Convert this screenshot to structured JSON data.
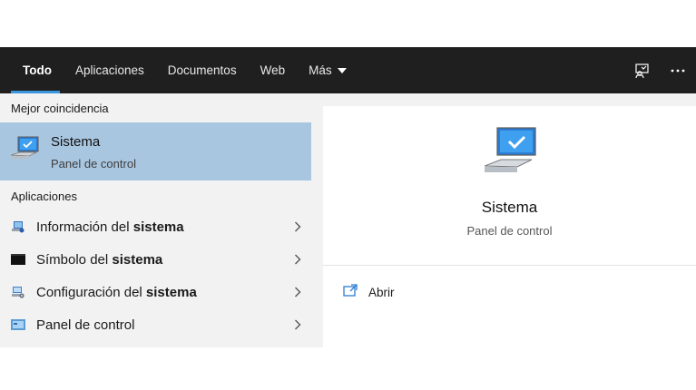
{
  "tabs": [
    {
      "label": "Todo",
      "active": true
    },
    {
      "label": "Aplicaciones"
    },
    {
      "label": "Documentos"
    },
    {
      "label": "Web"
    },
    {
      "label": "Más"
    }
  ],
  "top_icons": [
    "feedback-icon",
    "more-options-icon"
  ],
  "best_match": {
    "section_label": "Mejor coincidencia",
    "title": "Sistema",
    "subtitle": "Panel de control",
    "icon": "computer-icon"
  },
  "apps": {
    "section_label": "Aplicaciones",
    "items": [
      {
        "prefix": "Información del ",
        "bold": "sistema",
        "icon": "system-info-icon"
      },
      {
        "prefix": "Símbolo del ",
        "bold": "sistema",
        "icon": "command-prompt-icon"
      },
      {
        "prefix": "Configuración del ",
        "bold": "sistema",
        "icon": "system-config-icon"
      },
      {
        "prefix": "Panel de control",
        "bold": "",
        "icon": "control-panel-icon"
      }
    ]
  },
  "preview": {
    "title": "Sistema",
    "subtitle": "Panel de control",
    "icon": "computer-icon",
    "action_label": "Abrir",
    "action_icon": "open-icon"
  },
  "colors": {
    "topbar": "#1f1f1f",
    "accent": "#3a96dd",
    "selected": "#a9c6e0",
    "panel": "#f2f2f2"
  }
}
